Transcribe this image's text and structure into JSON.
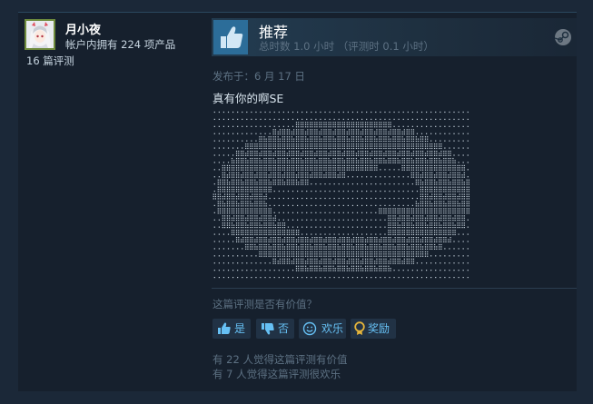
{
  "reviewer": {
    "name": "月小夜",
    "products_owned": "帐户内拥有 224 项产品",
    "reviews_count": "16 篇评测"
  },
  "review": {
    "verdict": "推荐",
    "hours": "总时数 1.0 小时  （评测时 0.1 小时）",
    "posted": "发布于：6 月 17 日",
    "text": "真有你的啊SE"
  },
  "feedback": {
    "question": "这篇评测是否有价值？",
    "yes_label": "是",
    "no_label": "否",
    "funny_label": "欢乐",
    "award_label": "奖励",
    "helpful_count": "有 22 人觉得这篇评测有价值",
    "funny_count": "有 7 人觉得这篇评测很欢乐"
  },
  "icons": {
    "thumbs_up": "thumbs-up-icon",
    "thumbs_down": "thumbs-down-icon",
    "smile": "smiley-icon",
    "award": "award-icon",
    "steam": "steam-logo-icon"
  },
  "colors": {
    "background": "#1b2838",
    "card": "#16202d",
    "accent": "#66c0f4",
    "recommend_blue": "#2c6d99",
    "muted": "#5d7183",
    "award_gold": "#e5b53b"
  }
}
